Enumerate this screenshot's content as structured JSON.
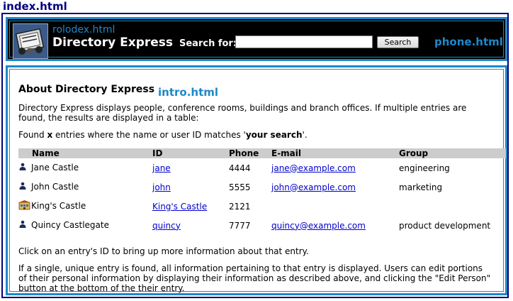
{
  "file_label": "index.html",
  "header": {
    "rolodex_link": "rolodex.html",
    "app_title": "Directory Express",
    "search_label": "Search for:",
    "search_value": "",
    "search_button": "Search",
    "phone_link": "phone.html"
  },
  "content": {
    "title": "About Directory Express",
    "intro_link": "intro.html",
    "description": "Directory Express displays people, conference rooms, buildings and branch offices. If multiple entries are found, the results are displayed in a table:",
    "found_prefix": "Found ",
    "found_x": "x",
    "found_middle": " entries where the name or user ID matches '",
    "found_search": "your search",
    "found_suffix": "'.",
    "table": {
      "headers": [
        "Name",
        "ID",
        "Phone",
        "E-mail",
        "Group"
      ],
      "rows": [
        {
          "icon": "person-icon",
          "name": "Jane Castle",
          "id": "jane",
          "phone": "4444",
          "email": "jane@example.com",
          "group": "engineering"
        },
        {
          "icon": "person-icon",
          "name": "John Castle",
          "id": "john",
          "phone": "5555",
          "email": "john@example.com",
          "group": "marketing"
        },
        {
          "icon": "building-icon",
          "name": "King's Castle",
          "id": "King's Castle",
          "phone": "2121",
          "email": "",
          "group": ""
        },
        {
          "icon": "person-icon",
          "name": "Quincy Castlegate",
          "id": "quincy",
          "phone": "7777",
          "email": "quincy@example.com",
          "group": "product development"
        }
      ]
    },
    "click_note": "Click on an entry's ID to bring up more information about that entry.",
    "single_note": "If a single, unique entry is found, all information pertaining to that entry is displayed. Users can edit portions of their personal information by displaying their information as described above, and clicking the \"Edit Person\" button at the bottom of the their entry."
  },
  "colors": {
    "accent": "#1e88c8",
    "frame": "#000080",
    "header_bg": "#000000",
    "table_header_bg": "#cccccc",
    "link": "#0000cc"
  }
}
